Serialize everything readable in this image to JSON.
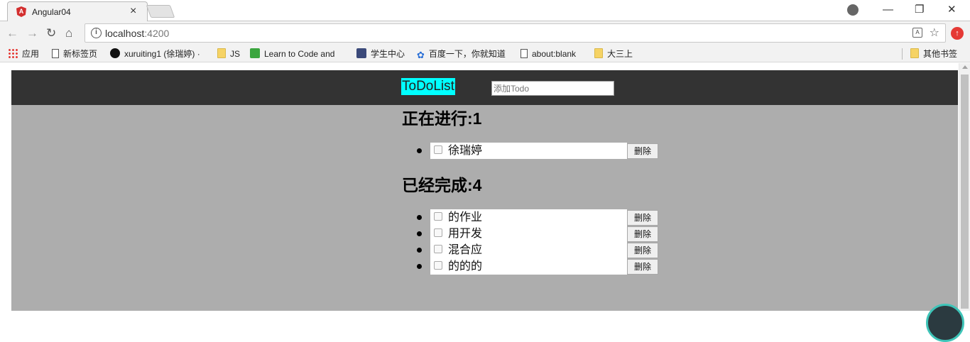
{
  "browser": {
    "tab": {
      "title": "Angular04",
      "close": "×"
    },
    "window_controls": {
      "minimize": "—",
      "restore": "❐",
      "close": "✕"
    },
    "nav": {
      "back": "←",
      "forward": "→",
      "reload": "↻",
      "home": "⌂"
    },
    "address": {
      "info": "i",
      "host": "localhost",
      "port": ":4200"
    },
    "bookmarks": [
      {
        "label": "应用",
        "icon": "apps-icon"
      },
      {
        "label": "新标签页",
        "icon": "page-icon"
      },
      {
        "label": "xuruiting1 (徐瑞婷) ·",
        "icon": "github-icon"
      },
      {
        "label": "JS",
        "icon": "folder-icon"
      },
      {
        "label": "Learn to Code and",
        "icon": "learn-icon"
      },
      {
        "label": "学生中心",
        "icon": "student-icon"
      },
      {
        "label": "百度一下，你就知道",
        "icon": "baidu-icon"
      },
      {
        "label": "about:blank",
        "icon": "page-icon"
      },
      {
        "label": "大三上",
        "icon": "folder-icon"
      }
    ],
    "other_bookmarks": "其他书签"
  },
  "app": {
    "brand": "ToDoList",
    "add_placeholder": "添加Todo",
    "ongoing_heading": "正在进行:1",
    "done_heading": "已经完成:4",
    "delete_label": "删除",
    "ongoing": [
      "徐瑞婷"
    ],
    "done": [
      "的作业",
      "用开发",
      "混合应",
      "的的的"
    ]
  },
  "colors": {
    "header_bg": "#333333",
    "body_bg": "#adadad",
    "brand_bg": "#00ffff"
  }
}
